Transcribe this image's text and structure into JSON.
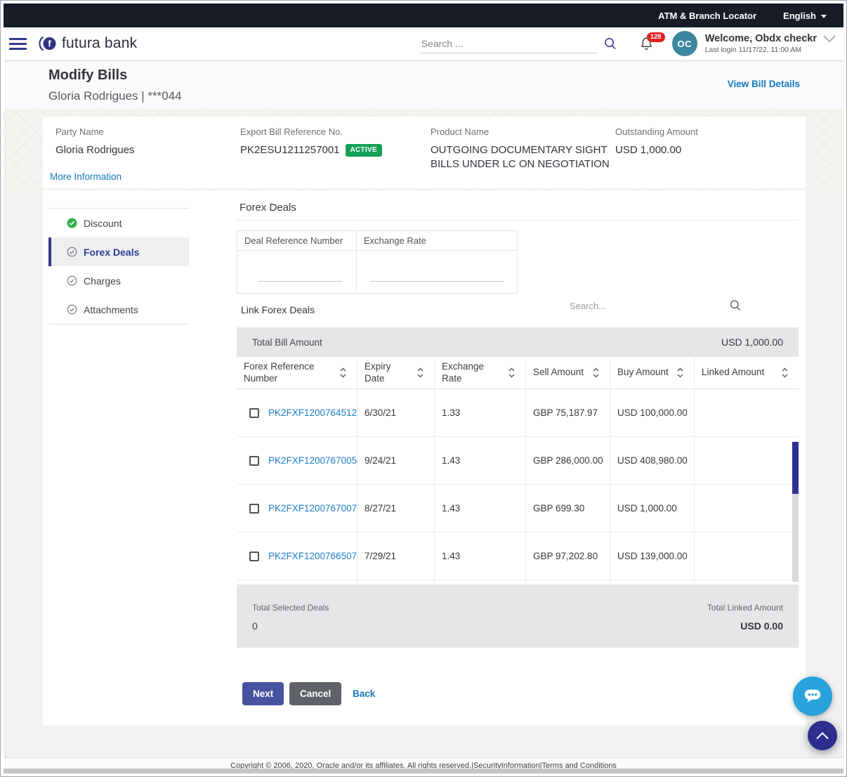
{
  "topbar": {
    "atm_locator": "ATM & Branch Locator",
    "language": "English"
  },
  "header": {
    "brand": "futura bank",
    "search_placeholder": "Search ...",
    "notification_count": "128",
    "avatar_initials": "OC",
    "welcome": "Welcome, Obdx checkr",
    "last_login": "Last login 11/17/22, 11:00 AM"
  },
  "page": {
    "title": "Modify Bills",
    "subtitle": "Gloria Rodrigues | ***044",
    "view_bill_details": "View Bill Details"
  },
  "bill_summary": {
    "fields": [
      {
        "label": "Party Name",
        "value": "Gloria Rodrigues"
      },
      {
        "label": "Export Bill Reference No.",
        "value": "PK2ESU1211257001",
        "badge": "ACTIVE"
      },
      {
        "label": "Product Name",
        "value": "OUTGOING DOCUMENTARY SIGHT BILLS UNDER LC ON NEGOTIATION"
      },
      {
        "label": "Outstanding Amount",
        "value": "USD 1,000.00"
      }
    ],
    "more_information": "More Information"
  },
  "sidebar": {
    "items": [
      {
        "label": "Discount",
        "state": "complete"
      },
      {
        "label": "Forex Deals",
        "state": "active"
      },
      {
        "label": "Charges",
        "state": "pending"
      },
      {
        "label": "Attachments",
        "state": "pending"
      }
    ]
  },
  "forex": {
    "section_title": "Forex Deals",
    "filter": {
      "col1": "Deal Reference Number",
      "col2": "Exchange Rate",
      "deal_ref_value": "",
      "exchange_rate_value": ""
    },
    "link_title": "Link Forex Deals",
    "search_placeholder": "Search...",
    "total_bill_label": "Total Bill Amount",
    "total_bill_value": "USD 1,000.00",
    "table": {
      "columns": [
        "Forex Reference Number",
        "Expiry Date",
        "Exchange Rate",
        "Sell Amount",
        "Buy Amount",
        "Linked Amount"
      ],
      "rows": [
        {
          "ref": "PK2FXF1200764512",
          "expiry": "6/30/21",
          "rate": "1.33",
          "sell": "GBP 75,187.97",
          "buy": "USD 100,000.00",
          "linked": ""
        },
        {
          "ref": "PK2FXF1200767005",
          "expiry": "9/24/21",
          "rate": "1.43",
          "sell": "GBP 286,000.00",
          "buy": "USD 408,980.00",
          "linked": ""
        },
        {
          "ref": "PK2FXF1200767007",
          "expiry": "8/27/21",
          "rate": "1.43",
          "sell": "GBP 699.30",
          "buy": "USD 1,000.00",
          "linked": ""
        },
        {
          "ref": "PK2FXF1200766507",
          "expiry": "7/29/21",
          "rate": "1.43",
          "sell": "GBP 97,202.80",
          "buy": "USD 139,000.00",
          "linked": ""
        }
      ]
    },
    "totals": {
      "selected_label": "Total Selected Deals",
      "selected_value": "0",
      "linked_label": "Total Linked Amount",
      "linked_value": "USD 0.00"
    }
  },
  "actions": {
    "next": "Next",
    "cancel": "Cancel",
    "back": "Back"
  },
  "footer": {
    "copyright": "Copyright © 2006, 2020, Oracle and/or its affiliates. All rights reserved.|SecurityInformation|Terms and Conditions"
  },
  "colors": {
    "accent_indigo": "#333a8c",
    "link_blue": "#1478be",
    "status_green": "#12a155",
    "topbar_dark": "#171c26",
    "notification_red": "#e02020",
    "chat_blue": "#29a3dc",
    "scroll_thumb": "#2e3192",
    "avatar_teal": "#3d86a0"
  },
  "icons": [
    "menu-icon",
    "futura-logo-icon",
    "search-icon",
    "bell-icon",
    "chevron-down-icon",
    "caret-down-icon",
    "check-filled-icon",
    "check-outline-icon",
    "sort-icon",
    "chat-bubble-icon",
    "chevron-up-icon"
  ]
}
